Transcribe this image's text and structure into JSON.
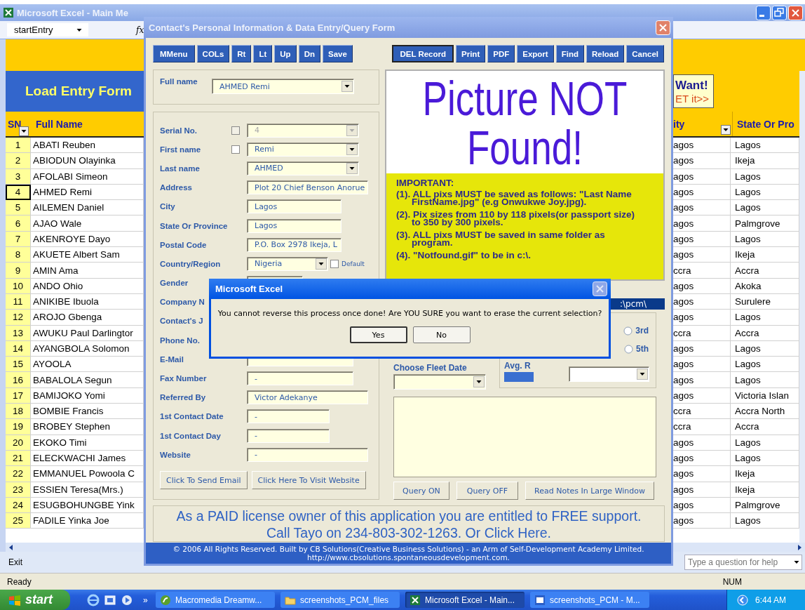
{
  "excel": {
    "title": "Microsoft Excel - Main Me",
    "name_box": "startEntry",
    "fx": "fx",
    "banner": "Load Entry Form",
    "promo": [
      "Want!",
      "ET it>>"
    ],
    "left_columns": [
      {
        "label": "SN",
        "filter": true
      },
      {
        "label": "Full Name",
        "filter": false
      }
    ],
    "right_columns": [
      {
        "label": "ity",
        "filter": true
      },
      {
        "label": "State Or Pro",
        "filter": false
      }
    ],
    "rows": [
      {
        "sn": "1",
        "name": "ABATI Reuben",
        "city": "agos",
        "state": "Lagos",
        "selected": false
      },
      {
        "sn": "2",
        "name": "ABIODUN Olayinka",
        "city": "agos",
        "state": "Ikeja",
        "selected": false
      },
      {
        "sn": "3",
        "name": "AFOLABI Simeon",
        "city": "agos",
        "state": "Lagos",
        "selected": false
      },
      {
        "sn": "4",
        "name": "AHMED Remi",
        "city": "agos",
        "state": "Lagos",
        "selected": true
      },
      {
        "sn": "5",
        "name": "AILEMEN Daniel",
        "city": "agos",
        "state": "Lagos",
        "selected": false
      },
      {
        "sn": "6",
        "name": "AJAO Wale",
        "city": "agos",
        "state": "Palmgrove",
        "selected": false
      },
      {
        "sn": "7",
        "name": "AKENROYE Dayo",
        "city": "agos",
        "state": "Lagos",
        "selected": false
      },
      {
        "sn": "8",
        "name": "AKUETE Albert Sam",
        "city": "agos",
        "state": "Ikeja",
        "selected": false
      },
      {
        "sn": "9",
        "name": "AMIN Ama",
        "city": "ccra",
        "state": "Accra",
        "selected": false
      },
      {
        "sn": "10",
        "name": "ANDO Ohio",
        "city": "agos",
        "state": "Akoka",
        "selected": false
      },
      {
        "sn": "11",
        "name": "ANIKIBE Ibuola",
        "city": "agos",
        "state": "Surulere",
        "selected": false
      },
      {
        "sn": "12",
        "name": "AROJO Gbenga",
        "city": "agos",
        "state": "Lagos",
        "selected": false
      },
      {
        "sn": "13",
        "name": "AWUKU Paul Darlingtor",
        "city": "ccra",
        "state": "Accra",
        "selected": false
      },
      {
        "sn": "14",
        "name": "AYANGBOLA Solomon",
        "city": "agos",
        "state": "Lagos",
        "selected": false
      },
      {
        "sn": "15",
        "name": "AYOOLA",
        "city": "agos",
        "state": "Lagos",
        "selected": false
      },
      {
        "sn": "16",
        "name": "BABALOLA Segun",
        "city": "agos",
        "state": "Lagos",
        "selected": false
      },
      {
        "sn": "17",
        "name": "BAMIJOKO Yomi",
        "city": "agos",
        "state": "Victoria Islan",
        "selected": false
      },
      {
        "sn": "18",
        "name": "BOMBIE Francis",
        "city": "ccra",
        "state": "Accra North",
        "selected": false
      },
      {
        "sn": "19",
        "name": "BROBEY Stephen",
        "city": "ccra",
        "state": "Accra",
        "selected": false
      },
      {
        "sn": "20",
        "name": "EKOKO Timi",
        "city": "agos",
        "state": "Lagos",
        "selected": false
      },
      {
        "sn": "21",
        "name": "ELECKWACHI James",
        "city": "agos",
        "state": "Lagos",
        "selected": false
      },
      {
        "sn": "22",
        "name": "EMMANUEL Powoola C",
        "city": "agos",
        "state": "Ikeja",
        "selected": false
      },
      {
        "sn": "23",
        "name": "ESSIEN Teresa(Mrs.)",
        "city": "agos",
        "state": "Ikeja",
        "selected": false
      },
      {
        "sn": "24",
        "name": "ESUGBOHUNGBE Yink",
        "city": "agos",
        "state": "Palmgrove",
        "selected": false
      },
      {
        "sn": "25",
        "name": "FADILE Yinka Joe",
        "city": "agos",
        "state": "Lagos",
        "selected": false
      }
    ],
    "exit": "Exit",
    "help": {
      "placeholder": "Type a question for help"
    },
    "status": "Ready",
    "num": "NUM"
  },
  "form": {
    "title": "Contact's Personal Information & Data Entry/Query Form",
    "left_buttons": [
      {
        "label": "MMenu",
        "selected": false
      },
      {
        "label": "COLs",
        "selected": false
      },
      {
        "label": "Rt",
        "selected": false
      },
      {
        "label": "Lt",
        "selected": false
      },
      {
        "label": "Up",
        "selected": false
      },
      {
        "label": "Dn",
        "selected": false
      },
      {
        "label": "Save",
        "selected": false
      }
    ],
    "right_buttons": [
      {
        "label": "DEL Record",
        "selected": true
      },
      {
        "label": "Print",
        "selected": false
      },
      {
        "label": "PDF",
        "selected": false
      },
      {
        "label": "Export",
        "selected": false
      },
      {
        "label": "Find",
        "selected": false
      },
      {
        "label": "Reload",
        "selected": false
      },
      {
        "label": "Cancel",
        "selected": false
      }
    ],
    "full_name": {
      "label": "Full name",
      "value": "AHMED Remi"
    },
    "fields": [
      {
        "label": "Serial No.",
        "kind": "combo",
        "value": "4",
        "disabled": true,
        "check": {
          "checked": false
        }
      },
      {
        "label": "First name",
        "kind": "combo",
        "value": "Remi",
        "disabled": false,
        "check": {
          "checked": false
        }
      },
      {
        "label": "Last name",
        "kind": "combo",
        "value": "AHMED",
        "disabled": false
      },
      {
        "label": "Address",
        "kind": "text",
        "value": "Plot 20 Chief Benson Anorue",
        "disabled": false
      },
      {
        "label": "City",
        "kind": "text",
        "value": "Lagos",
        "disabled": false
      },
      {
        "label": "State Or Province",
        "kind": "text",
        "value": "Lagos",
        "disabled": false
      },
      {
        "label": "Postal Code",
        "kind": "text",
        "value": "P.O. Box 2978 Ikeja, L",
        "disabled": false
      },
      {
        "label": "Country/Region",
        "kind": "combo",
        "value": "Nigeria",
        "disabled": false,
        "option": {
          "label": "Default",
          "checked": false
        }
      },
      {
        "label": "Gender",
        "kind": "text"
      },
      {
        "label": "Company N",
        "kind": "hidden"
      },
      {
        "label": "Contact's J",
        "kind": "hidden"
      },
      {
        "label": "Phone No.",
        "kind": "hidden"
      },
      {
        "label": "E-Mail",
        "kind": "text"
      },
      {
        "label": "Fax Number",
        "kind": "text",
        "value": "-",
        "disabled": false
      },
      {
        "label": "Referred By",
        "kind": "text",
        "value": "Victor Adekanye",
        "disabled": false
      },
      {
        "label": "1st Contact Date",
        "kind": "text",
        "value": "-",
        "disabled": false
      },
      {
        "label": "1st Contact Day",
        "kind": "text",
        "value": "-",
        "disabled": false
      },
      {
        "label": "Website",
        "kind": "text",
        "value": "-",
        "disabled": false
      }
    ],
    "left_actions": [
      "Click To Send Email",
      "Click Here To Visit Website"
    ],
    "picture_message": [
      "Picture NOT",
      "Found!"
    ],
    "notice": {
      "heading": "IMPORTANT:",
      "items": [
        "(1). ALL pixs MUST be saved as follows: \"Last Name FirstName.jpg\" (e.g Onwukwe Joy.jpg).",
        "(2). Pix sizes from 110 by 118 pixels(or passport size) to 350 by 300 pixels.",
        "(3). ALL pixs MUST be saved in same folder as program.",
        "(4). \"Notfound.gif\" to be in c:\\."
      ]
    },
    "path": ":\\pcm\\",
    "radios": [
      {
        "label": "3rd",
        "selected": false
      },
      {
        "label": "5th",
        "selected": false
      }
    ],
    "fleet_date_label": "Choose Fleet Date",
    "avg_label": "Avg. R",
    "right_actions": [
      "Query ON",
      "Query OFF",
      "Read Notes In Large Window"
    ],
    "support": [
      "As a PAID license owner of this application you are entitled to FREE support.",
      "Call Tayo on 234-803-302-1263. Or Click Here."
    ],
    "footer": [
      "© 2006 All Rights Reserved. Built by CB Solutions(Creative Business Solutions) - an Arm of Self-Development Academy Limited.",
      "http://www.cbsolutions.spontaneousdevelopment.com."
    ]
  },
  "dialog": {
    "title": "Microsoft Excel",
    "message": "You cannot reverse this process once done! Are YOU SURE you want to erase the current selection?",
    "buttons": [
      {
        "label": "Yes",
        "selected": true
      },
      {
        "label": "No",
        "selected": false
      }
    ]
  },
  "taskbar": {
    "start": "start",
    "more": "»",
    "tasks": [
      {
        "label": "Macromedia Dreamw...",
        "kind": "dreamweaver",
        "selected": false
      },
      {
        "label": "screenshots_PCM_files",
        "kind": "folder",
        "selected": false
      },
      {
        "label": "Microsoft Excel - Main...",
        "kind": "excel",
        "selected": true
      },
      {
        "label": "screenshots_PCM - M...",
        "kind": "word",
        "selected": false
      }
    ],
    "clock": "6:44 AM"
  }
}
